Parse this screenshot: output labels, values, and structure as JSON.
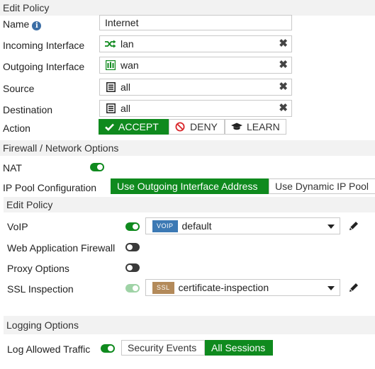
{
  "header": {
    "title": "Edit Policy"
  },
  "form": {
    "name_label": "Name",
    "name_value": "Internet",
    "incoming_label": "Incoming Interface",
    "incoming_value": "lan",
    "outgoing_label": "Outgoing Interface",
    "outgoing_value": "wan",
    "source_label": "Source",
    "source_value": "all",
    "destination_label": "Destination",
    "destination_value": "all",
    "action_label": "Action",
    "action_buttons": [
      "ACCEPT",
      "DENY",
      "LEARN"
    ],
    "action_selected": "ACCEPT"
  },
  "firewall": {
    "title": "Firewall / Network Options",
    "nat_label": "NAT",
    "nat_enabled": true,
    "ippool_label": "IP Pool Configuration",
    "ippool_options": [
      "Use Outgoing Interface Address",
      "Use Dynamic IP Pool"
    ],
    "ippool_selected": "Use Outgoing Interface Address"
  },
  "security": {
    "title": "Edit Policy",
    "voip_label": "VoIP",
    "voip_enabled": true,
    "voip_tag": "VOIP",
    "voip_profile": "default",
    "waf_label": "Web Application Firewall",
    "waf_enabled": false,
    "proxy_label": "Proxy Options",
    "proxy_enabled": false,
    "ssl_label": "SSL Inspection",
    "ssl_enabled": true,
    "ssl_tag": "SSL",
    "ssl_profile": "certificate-inspection"
  },
  "logging": {
    "title": "Logging Options",
    "log_label": "Log Allowed Traffic",
    "log_enabled": true,
    "options": [
      "Security Events",
      "All Sessions"
    ],
    "selected": "All Sessions"
  },
  "colors": {
    "accent_green": "#0f8a1e",
    "voip_tag": "#3c79b4",
    "ssl_tag": "#b38a5a",
    "section_bg": "#f2f2f2"
  },
  "icons": {
    "info": "info-icon",
    "incoming": "shuffle-icon",
    "outgoing": "network-icon",
    "address": "address-list-icon",
    "clear": "close-icon",
    "accept": "check-icon",
    "deny": "ban-icon",
    "learn": "graduation-cap-icon",
    "edit": "pencil-icon",
    "dropdown": "chevron-down-icon"
  }
}
